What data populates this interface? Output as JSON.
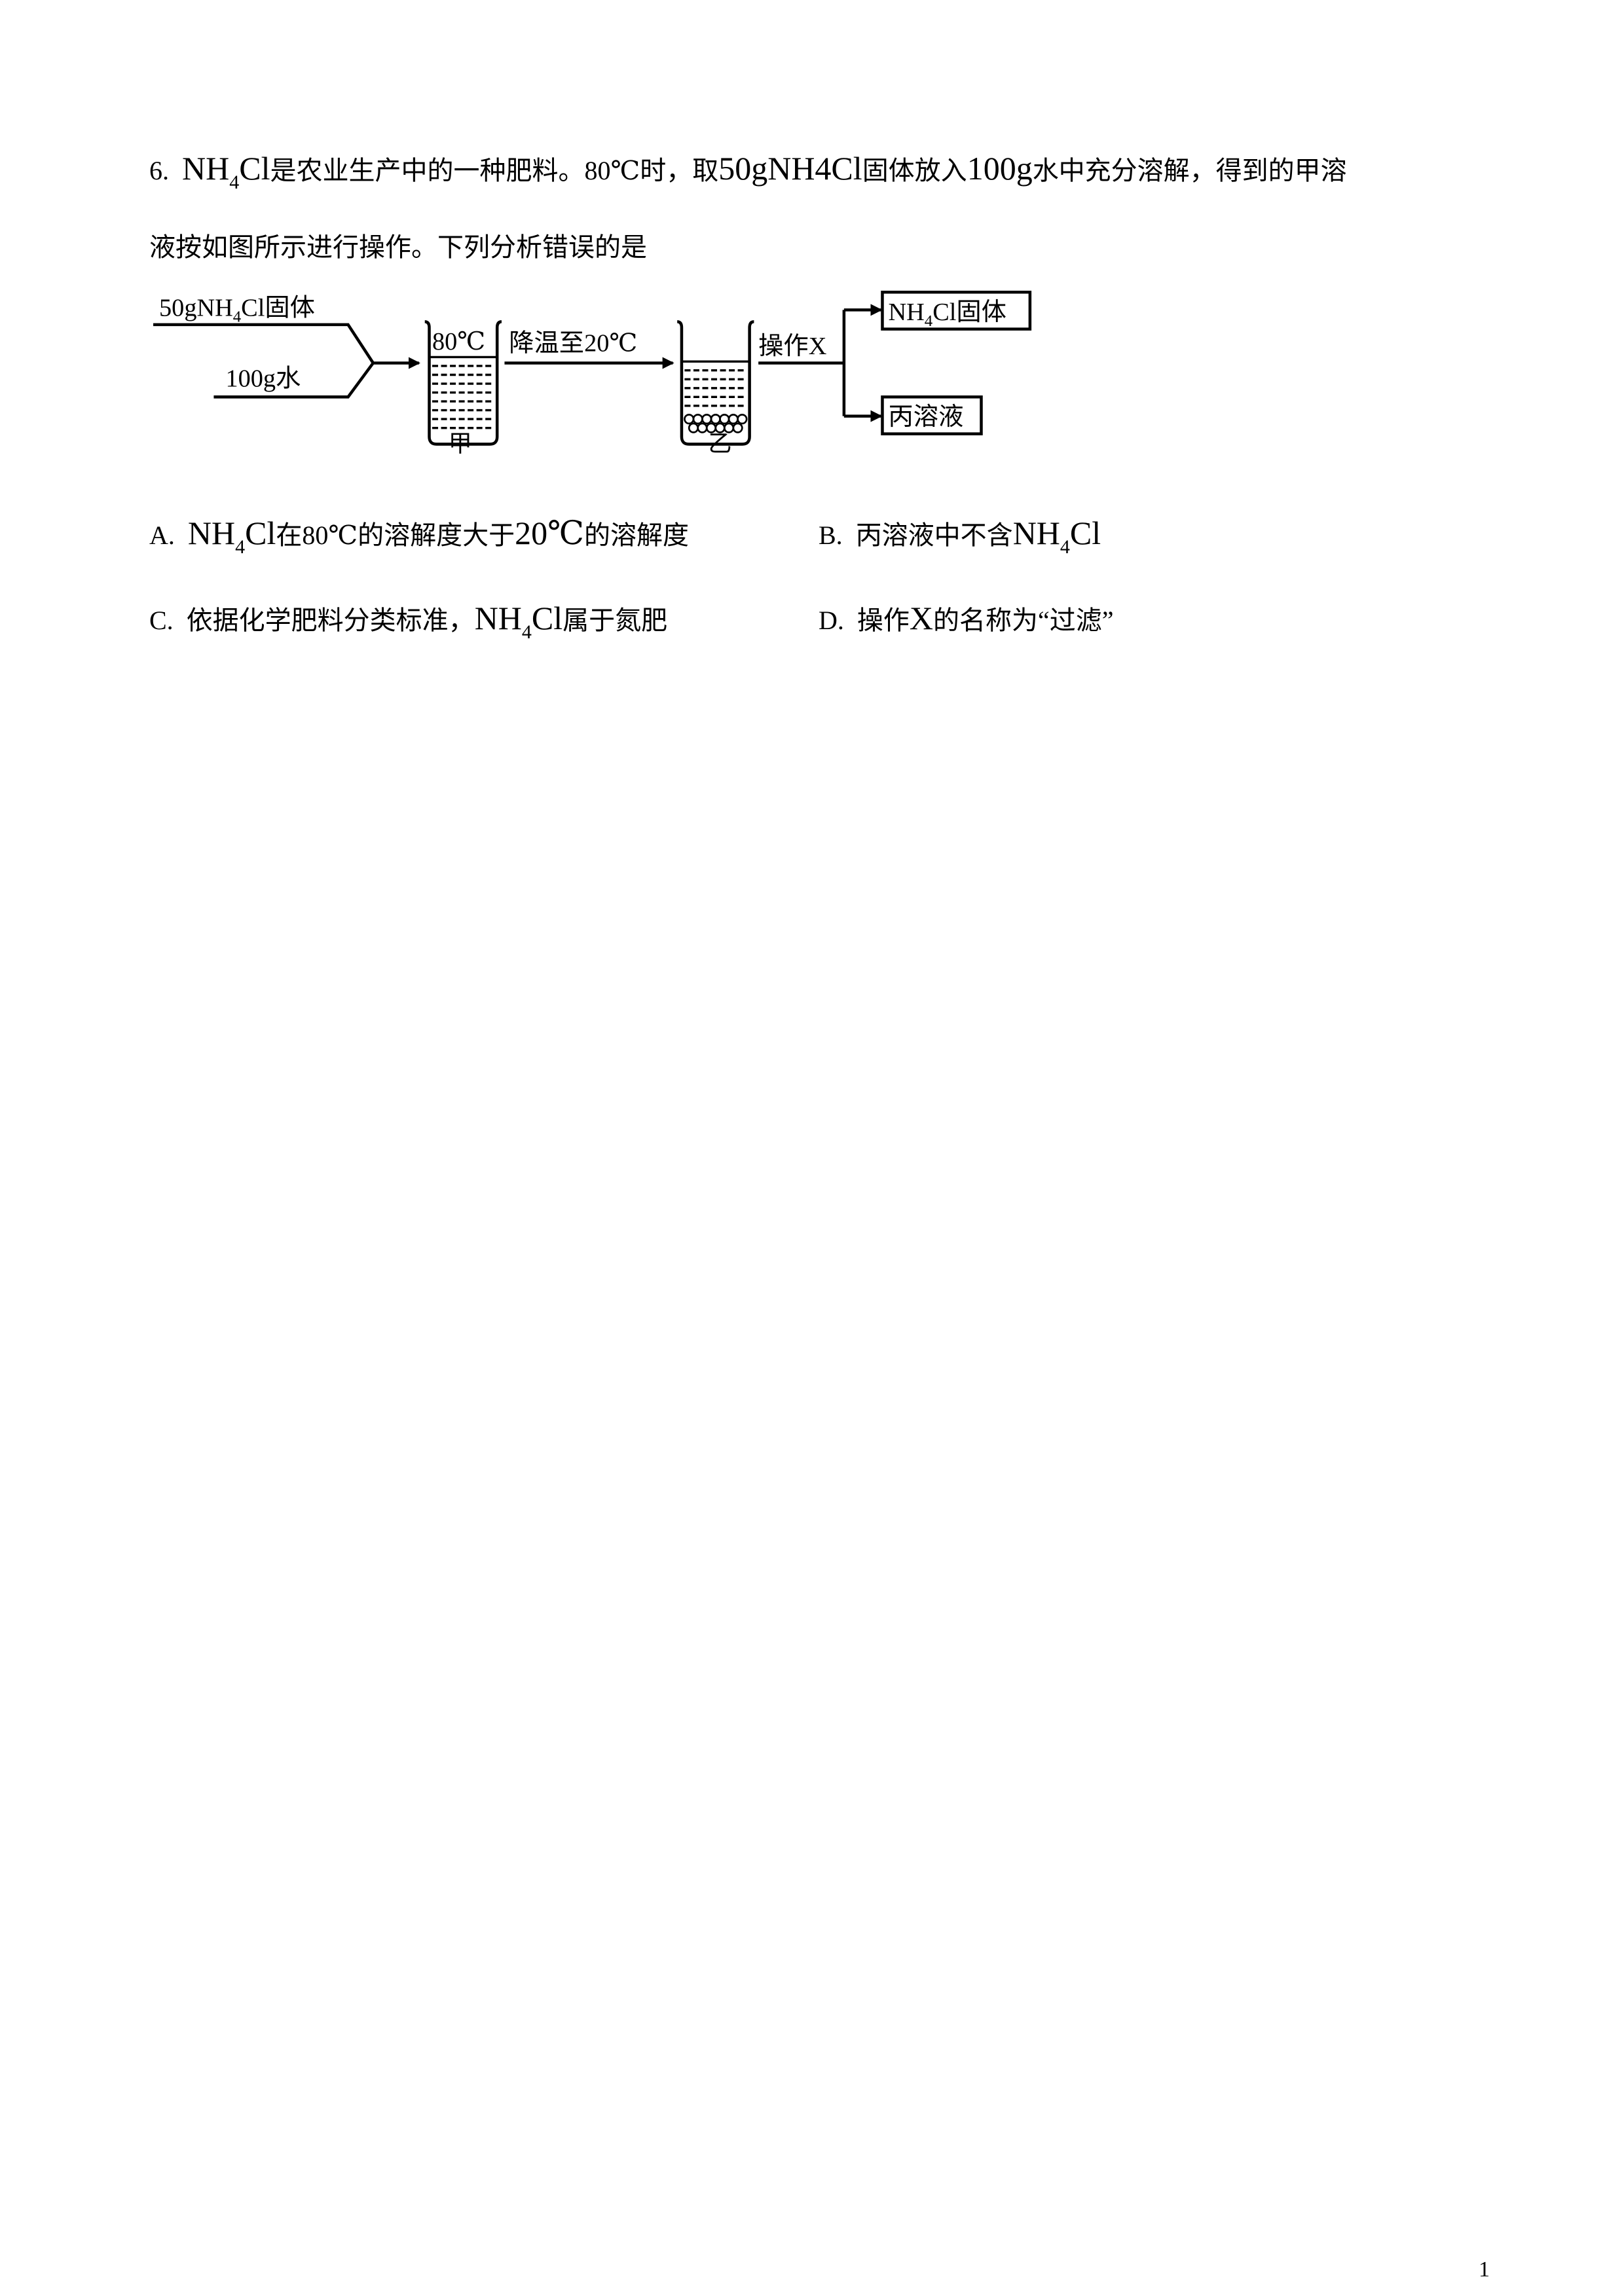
{
  "question": {
    "number": "6.",
    "line1_parts": [
      "NH",
      "4",
      "Cl",
      "是农业生产中的一种肥料。80℃时，取",
      "50gNH4Cl",
      "固体放入",
      "100g",
      "水中充分溶解，得到的甲溶"
    ],
    "line2": "液按如图所示进行操作。下列分析错误的是"
  },
  "diagram": {
    "input1_parts": [
      "50gNH",
      "4",
      "Cl固体"
    ],
    "input2": "100g水",
    "beaker1_temp": "80℃",
    "beaker1_label": "甲",
    "step1": "降温至20℃",
    "beaker2_label": "乙",
    "step2": "操作X",
    "output1_parts": [
      "NH",
      "4",
      "Cl固体"
    ],
    "output2": "丙溶液"
  },
  "options": {
    "A": {
      "letter": "A.",
      "parts": [
        "NH",
        "4",
        "Cl",
        "在80℃的溶解度大于",
        "20℃",
        "的溶解度"
      ]
    },
    "B": {
      "letter": "B.",
      "parts": [
        "丙溶液中不含",
        "NH",
        "4",
        "Cl"
      ]
    },
    "C": {
      "letter": "C.",
      "parts": [
        "依据化学肥料分类标准，",
        "NH",
        "4",
        "Cl",
        "属于氮肥"
      ]
    },
    "D": {
      "letter": "D.",
      "parts": [
        "操作",
        "X",
        "的名称为“过滤”"
      ]
    }
  },
  "page_number": "1"
}
